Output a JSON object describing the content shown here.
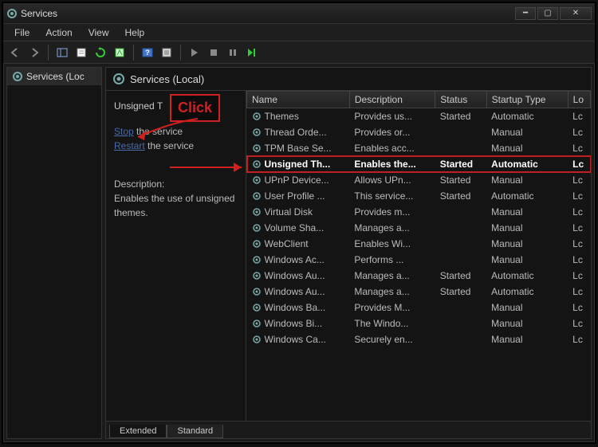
{
  "window": {
    "title": "Services"
  },
  "menu": {
    "file": "File",
    "action": "Action",
    "view": "View",
    "help": "Help"
  },
  "tree": {
    "root": "Services (Loc"
  },
  "panel_title": "Services (Local)",
  "detail": {
    "selected_name": "Unsigned T",
    "stop": "Stop",
    "stop_tail": " the service",
    "restart": "Restart",
    "restart_tail": " the service",
    "desc_label": "Description:",
    "desc_text": "Enables the use of unsigned themes."
  },
  "annotation": {
    "click": "Click"
  },
  "columns": {
    "name": "Name",
    "description": "Description",
    "status": "Status",
    "startup": "Startup Type",
    "logon": "Lo"
  },
  "rows": [
    {
      "name": "Themes",
      "desc": "Provides us...",
      "status": "Started",
      "startup": "Automatic",
      "logon": "Lc"
    },
    {
      "name": "Thread Orde...",
      "desc": "Provides or...",
      "status": "",
      "startup": "Manual",
      "logon": "Lc"
    },
    {
      "name": "TPM Base Se...",
      "desc": "Enables acc...",
      "status": "",
      "startup": "Manual",
      "logon": "Lc"
    },
    {
      "name": "Unsigned Th...",
      "desc": "Enables the...",
      "status": "Started",
      "startup": "Automatic",
      "logon": "Lc",
      "selected": true
    },
    {
      "name": "UPnP Device...",
      "desc": "Allows UPn...",
      "status": "Started",
      "startup": "Manual",
      "logon": "Lc"
    },
    {
      "name": "User Profile ...",
      "desc": "This service...",
      "status": "Started",
      "startup": "Automatic",
      "logon": "Lc"
    },
    {
      "name": "Virtual Disk",
      "desc": "Provides m...",
      "status": "",
      "startup": "Manual",
      "logon": "Lc"
    },
    {
      "name": "Volume Sha...",
      "desc": "Manages a...",
      "status": "",
      "startup": "Manual",
      "logon": "Lc"
    },
    {
      "name": "WebClient",
      "desc": "Enables Wi...",
      "status": "",
      "startup": "Manual",
      "logon": "Lc"
    },
    {
      "name": "Windows Ac...",
      "desc": "Performs ...",
      "status": "",
      "startup": "Manual",
      "logon": "Lc"
    },
    {
      "name": "Windows Au...",
      "desc": "Manages a...",
      "status": "Started",
      "startup": "Automatic",
      "logon": "Lc"
    },
    {
      "name": "Windows Au...",
      "desc": "Manages a...",
      "status": "Started",
      "startup": "Automatic",
      "logon": "Lc"
    },
    {
      "name": "Windows Ba...",
      "desc": "Provides M...",
      "status": "",
      "startup": "Manual",
      "logon": "Lc"
    },
    {
      "name": "Windows Bi...",
      "desc": "The Windo...",
      "status": "",
      "startup": "Manual",
      "logon": "Lc"
    },
    {
      "name": "Windows Ca...",
      "desc": "Securely en...",
      "status": "",
      "startup": "Manual",
      "logon": "Lc"
    }
  ],
  "tabs": {
    "extended": "Extended",
    "standard": "Standard"
  }
}
